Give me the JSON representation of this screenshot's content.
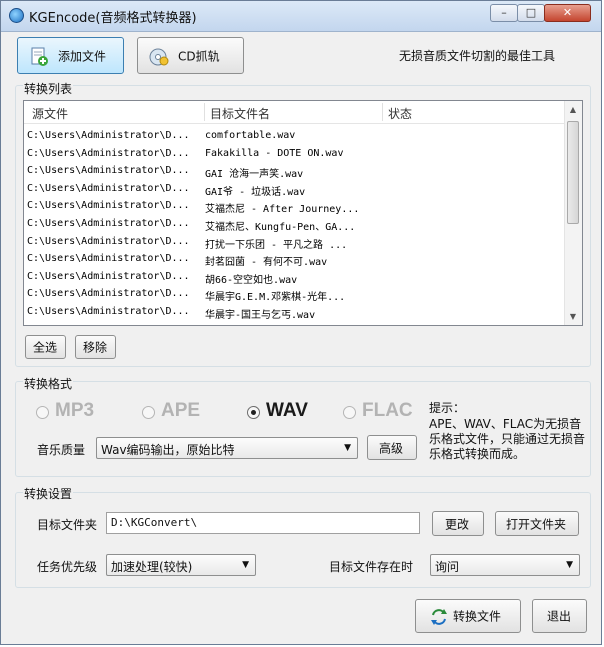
{
  "window": {
    "title": "KGEncode(音频格式转换器)",
    "controls": {
      "minimize": "–",
      "maximize": "□",
      "close": "✕"
    }
  },
  "toolbar": {
    "add_file_label": "添加文件",
    "cd_rip_label": "CD抓轨",
    "tagline": "无损音质文件切割的最佳工具"
  },
  "convert_list": {
    "title": "转换列表",
    "columns": [
      "源文件",
      "目标文件名",
      "状态"
    ],
    "rows": [
      {
        "source": "C:\\Users\\Administrator\\D...",
        "target": "comfortable.wav",
        "status": ""
      },
      {
        "source": "C:\\Users\\Administrator\\D...",
        "target": "Fakakilla - DOTE ON.wav",
        "status": ""
      },
      {
        "source": "C:\\Users\\Administrator\\D...",
        "target": "GAI 沧海一声笑.wav",
        "status": ""
      },
      {
        "source": "C:\\Users\\Administrator\\D...",
        "target": "GAI爷 - 垃圾话.wav",
        "status": ""
      },
      {
        "source": "C:\\Users\\Administrator\\D...",
        "target": "艾福杰尼 - After Journey...",
        "status": ""
      },
      {
        "source": "C:\\Users\\Administrator\\D...",
        "target": "艾福杰尼、Kungfu-Pen、GA...",
        "status": ""
      },
      {
        "source": "C:\\Users\\Administrator\\D...",
        "target": "打扰一下乐团 - 平凡之路 ...",
        "status": ""
      },
      {
        "source": "C:\\Users\\Administrator\\D...",
        "target": "封茗囧菌 - 有何不可.wav",
        "status": ""
      },
      {
        "source": "C:\\Users\\Administrator\\D...",
        "target": "胡66-空空如也.wav",
        "status": ""
      },
      {
        "source": "C:\\Users\\Administrator\\D...",
        "target": "华晨宇G.E.M.邓紫棋-光年...",
        "status": ""
      },
      {
        "source": "C:\\Users\\Administrator\\D...",
        "target": "华晨宇-国王与乞丐.wav",
        "status": ""
      }
    ],
    "select_all_label": "全选",
    "remove_label": "移除"
  },
  "format": {
    "title": "转换格式",
    "options": [
      "MP3",
      "APE",
      "WAV",
      "FLAC"
    ],
    "selected": "WAV",
    "quality_label": "音乐质量",
    "quality_value": "Wav编码输出，原始比特",
    "advanced_label": "高级",
    "hint_title": "提示：",
    "hint_text": "APE、WAV、FLAC为无损音乐格式文件，只能通过无损音乐格式转换而成。"
  },
  "settings": {
    "title": "转换设置",
    "target_folder_label": "目标文件夹",
    "target_folder_value": "D:\\KGConvert\\",
    "change_label": "更改",
    "open_folder_label": "打开文件夹",
    "priority_label": "任务优先级",
    "priority_value": "加速处理(较快)",
    "exists_label": "目标文件存在时",
    "exists_value": "询问"
  },
  "footer": {
    "convert_label": "转换文件",
    "exit_label": "退出"
  },
  "colors": {
    "accent": "#1c6fc2",
    "disabled_text": "#b3b3b3"
  }
}
